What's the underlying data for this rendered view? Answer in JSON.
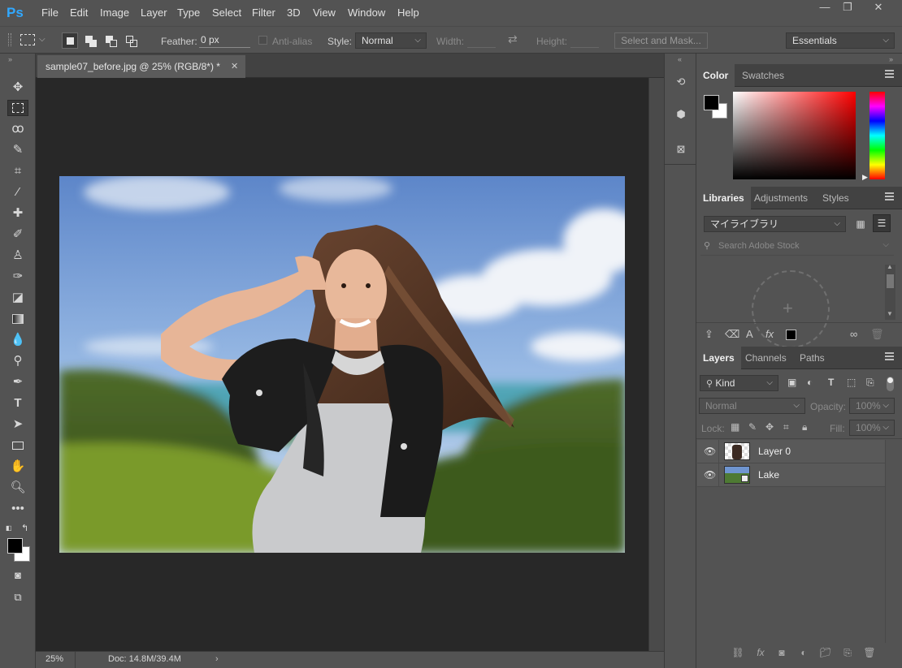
{
  "app": {
    "logo": "Ps"
  },
  "menu": [
    "File",
    "Edit",
    "Image",
    "Layer",
    "Type",
    "Select",
    "Filter",
    "3D",
    "View",
    "Window",
    "Help"
  ],
  "window_controls": [
    "—",
    "❐",
    "✕"
  ],
  "options": {
    "feather_label": "Feather:",
    "feather_value": "0 px",
    "antialias_label": "Anti-alias",
    "style_label": "Style:",
    "style_value": "Normal",
    "width_label": "Width:",
    "height_label": "Height:",
    "select_mask_label": "Select and Mask...",
    "workspace_value": "Essentials"
  },
  "document": {
    "tab_title": "sample07_before.jpg @ 25% (RGB/8*) *",
    "zoom": "25%",
    "doc_info": "Doc: 14.8M/39.4M"
  },
  "tools": [
    "move-tool",
    "rectangular-marquee-tool",
    "lasso-tool",
    "quick-selection-tool",
    "crop-tool",
    "eyedropper-tool",
    "healing-brush-tool",
    "brush-tool",
    "clone-stamp-tool",
    "history-brush-tool",
    "eraser-tool",
    "gradient-tool",
    "blur-tool",
    "dodge-tool",
    "pen-tool",
    "type-tool",
    "path-selection-tool",
    "rectangle-tool",
    "hand-tool",
    "zoom-tool",
    "more-tools"
  ],
  "color_panel": {
    "tabs": [
      "Color",
      "Swatches"
    ],
    "foreground": "#000000",
    "background": "#ffffff",
    "hue": "#ff0000"
  },
  "libraries_panel": {
    "tabs": [
      "Libraries",
      "Adjustments",
      "Styles"
    ],
    "library_name": "マイライブラリ",
    "search_placeholder": "Search Adobe Stock"
  },
  "layers_panel": {
    "tabs": [
      "Layers",
      "Channels",
      "Paths"
    ],
    "filter_kind": "Kind",
    "blend_mode": "Normal",
    "opacity_label": "Opacity:",
    "opacity_value": "100%",
    "lock_label": "Lock:",
    "fill_label": "Fill:",
    "fill_value": "100%",
    "layers": [
      {
        "name": "Layer 0",
        "visible": true
      },
      {
        "name": "Lake",
        "visible": true
      }
    ]
  }
}
